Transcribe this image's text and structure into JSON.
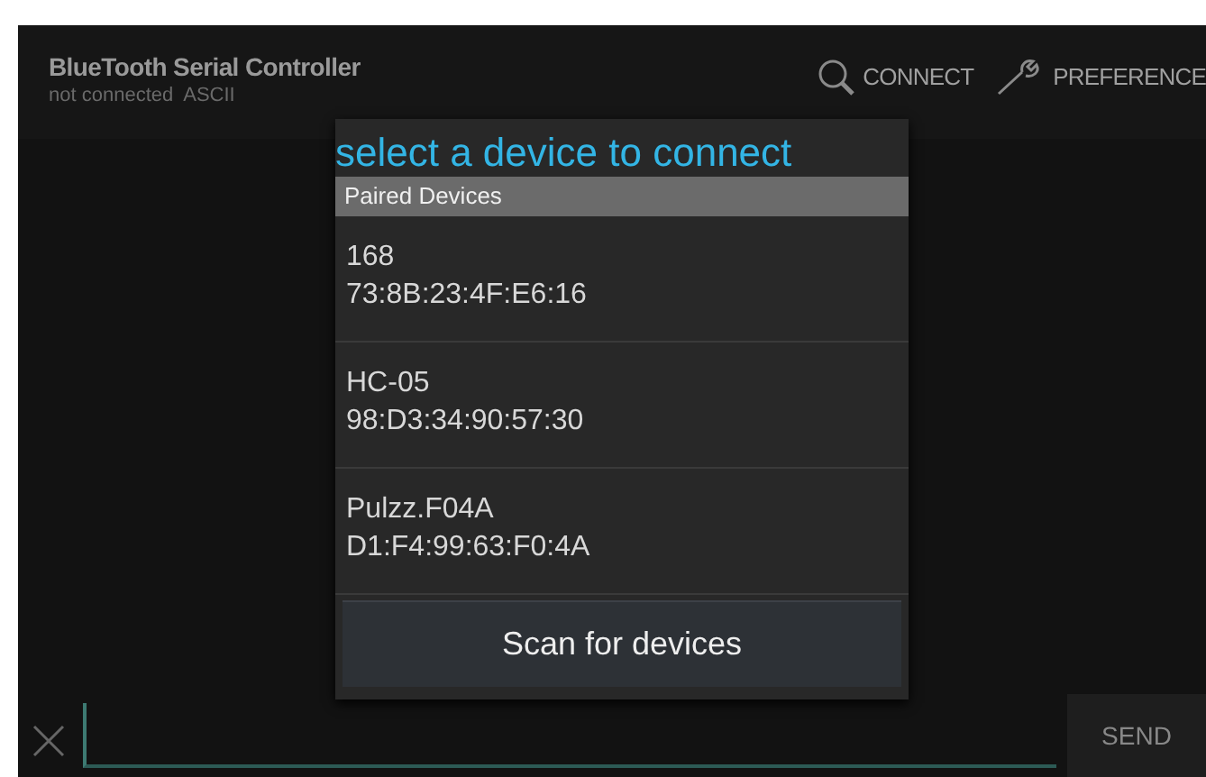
{
  "app_bar": {
    "title": "BlueTooth Serial Controller",
    "subtitle": "not connected  ASCII",
    "actions": [
      {
        "kind": "search",
        "label": "CONNECT"
      },
      {
        "kind": "wrench",
        "label": "PREFERENCE"
      }
    ]
  },
  "dialog": {
    "title": "select a device to connect",
    "section": "Paired Devices",
    "devices": [
      {
        "name": "168",
        "address": "73:8B:23:4F:E6:16"
      },
      {
        "name": "HC-05",
        "address": "98:D3:34:90:57:30"
      },
      {
        "name": "Pulzz.F04A",
        "address": "D1:F4:99:63:F0:4A"
      }
    ],
    "button": "Scan for devices"
  },
  "input_bar": {
    "send": "SEND"
  }
}
